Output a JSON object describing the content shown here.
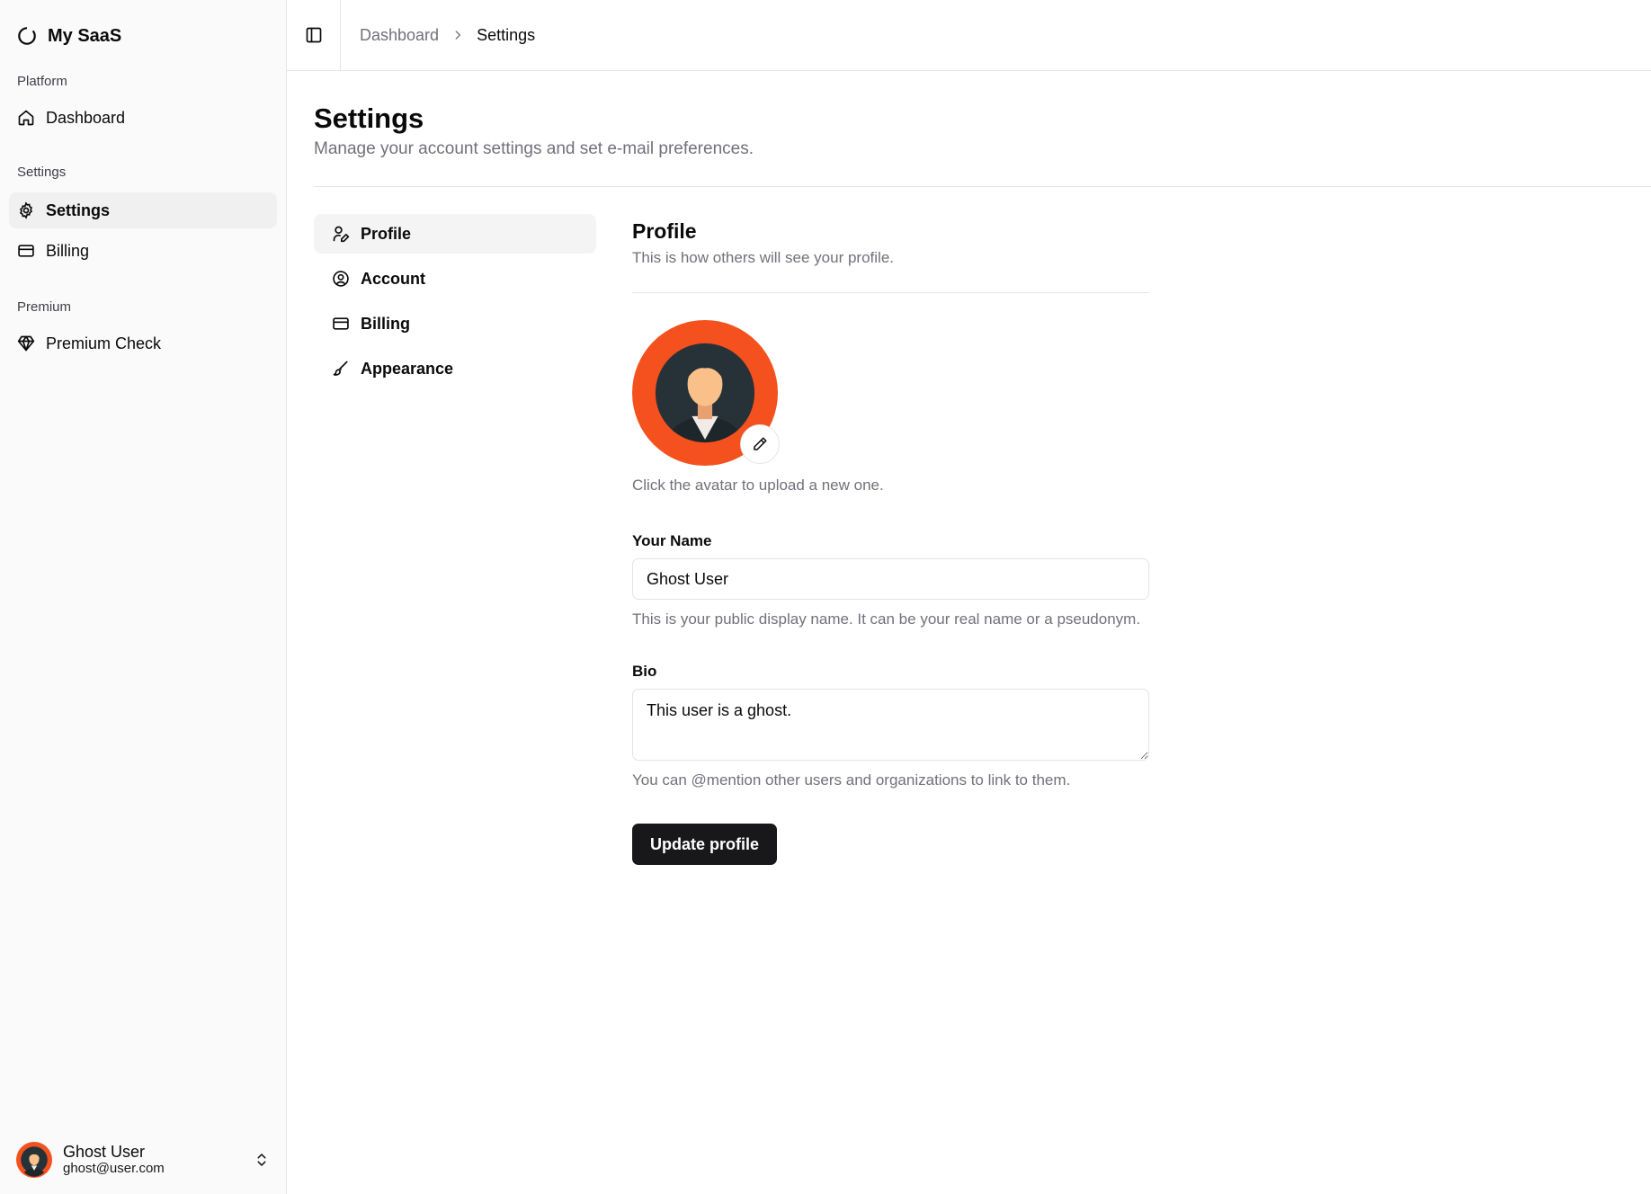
{
  "app": {
    "name": "My SaaS"
  },
  "sidebar": {
    "groups": [
      {
        "label": "Platform",
        "items": [
          {
            "label": "Dashboard",
            "icon": "home-icon"
          }
        ]
      },
      {
        "label": "Settings",
        "items": [
          {
            "label": "Settings",
            "icon": "gear-icon",
            "active": true
          },
          {
            "label": "Billing",
            "icon": "credit-card-icon"
          }
        ]
      },
      {
        "label": "Premium",
        "items": [
          {
            "label": "Premium Check",
            "icon": "gem-icon"
          }
        ]
      }
    ],
    "user": {
      "name": "Ghost User",
      "email": "ghost@user.com"
    }
  },
  "breadcrumb": {
    "parent": "Dashboard",
    "current": "Settings"
  },
  "page": {
    "title": "Settings",
    "subtitle": "Manage your account settings and set e-mail preferences."
  },
  "subnav": {
    "items": [
      {
        "label": "Profile",
        "icon": "user-pen-icon",
        "active": true
      },
      {
        "label": "Account",
        "icon": "user-circle-icon"
      },
      {
        "label": "Billing",
        "icon": "credit-card-icon"
      },
      {
        "label": "Appearance",
        "icon": "brush-icon"
      }
    ]
  },
  "profile": {
    "title": "Profile",
    "subtitle": "This is how others will see your profile.",
    "avatar_hint": "Click the avatar to upload a new one.",
    "name_label": "Your Name",
    "name_value": "Ghost User",
    "name_help": "This is your public display name. It can be your real name or a pseudonym.",
    "bio_label": "Bio",
    "bio_value": "This user is a ghost.",
    "bio_help": "You can @mention other users and organizations to link to them.",
    "submit_label": "Update profile"
  },
  "colors": {
    "accent": "#f4511e",
    "primary_button": "#18181b",
    "muted_text": "#71717a"
  }
}
